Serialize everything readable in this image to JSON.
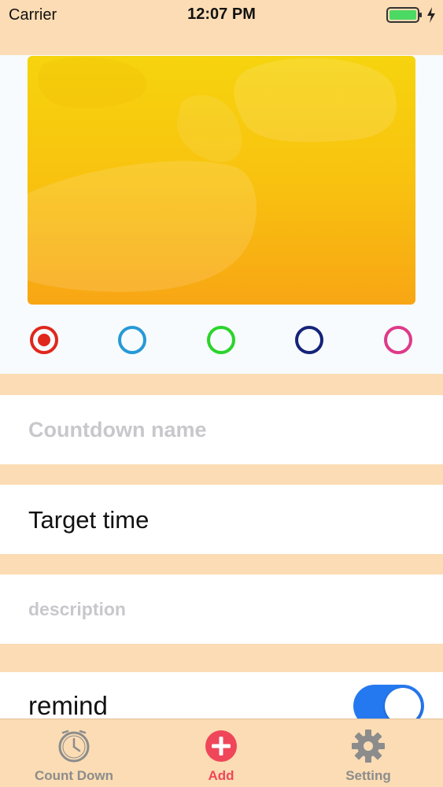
{
  "status_bar": {
    "carrier": "Carrier",
    "time": "12:07 PM"
  },
  "theme": {
    "colors": [
      "#e0271c",
      "#2799d6",
      "#2bd42b",
      "#16237a",
      "#df3a8a"
    ],
    "selected_index": 0
  },
  "form": {
    "name_placeholder": "Countdown name",
    "target_time_label": "Target time",
    "description_placeholder": "description",
    "remind_label": "remind",
    "remind_on": true
  },
  "tab_bar": {
    "tabs": [
      {
        "label": "Count Down",
        "icon": "clock-icon",
        "color": "#8c8c8c"
      },
      {
        "label": "Add",
        "icon": "add-icon",
        "color": "#f0465a"
      },
      {
        "label": "Setting",
        "icon": "gear-icon",
        "color": "#8c8c8c"
      }
    ],
    "active_color": "#f0465a"
  }
}
